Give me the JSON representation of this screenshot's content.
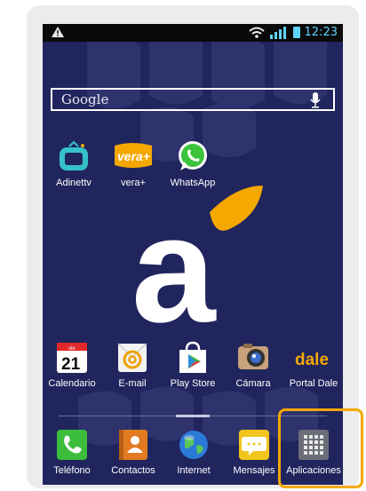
{
  "status_bar": {
    "time": "12:23",
    "warning_icon": "warning-icon",
    "wifi_icon": "wifi-icon",
    "signal_icon": "signal-icon",
    "battery_icon": "battery-icon"
  },
  "search": {
    "placeholder": "Google",
    "mic_icon": "mic-icon"
  },
  "top_apps": [
    {
      "label": "Adinettv",
      "icon": "tv-icon"
    },
    {
      "label": "vera+",
      "icon": "vera-icon"
    },
    {
      "label": "WhatsApp",
      "icon": "whatsapp-icon"
    }
  ],
  "row_apps": [
    {
      "label": "Calendario",
      "icon": "calendar-icon",
      "date_day": "vie",
      "date_num": "21"
    },
    {
      "label": "E-mail",
      "icon": "email-icon"
    },
    {
      "label": "Play Store",
      "icon": "play-store-icon"
    },
    {
      "label": "Cámara",
      "icon": "camera-icon"
    },
    {
      "label": "Portal Dale",
      "icon": "dale-icon",
      "icon_text": "dale"
    }
  ],
  "dock": [
    {
      "label": "Teléfono",
      "icon": "phone-icon"
    },
    {
      "label": "Contactos",
      "icon": "contacts-icon"
    },
    {
      "label": "Internet",
      "icon": "globe-icon"
    },
    {
      "label": "Mensajes",
      "icon": "messages-icon"
    },
    {
      "label": "Aplicaciones",
      "icon": "apps-grid-icon"
    }
  ],
  "wallpaper": {
    "logo_letter": "a",
    "brand_color": "#f5a800",
    "background_color": "#21255e"
  },
  "vera_text": "vera+"
}
